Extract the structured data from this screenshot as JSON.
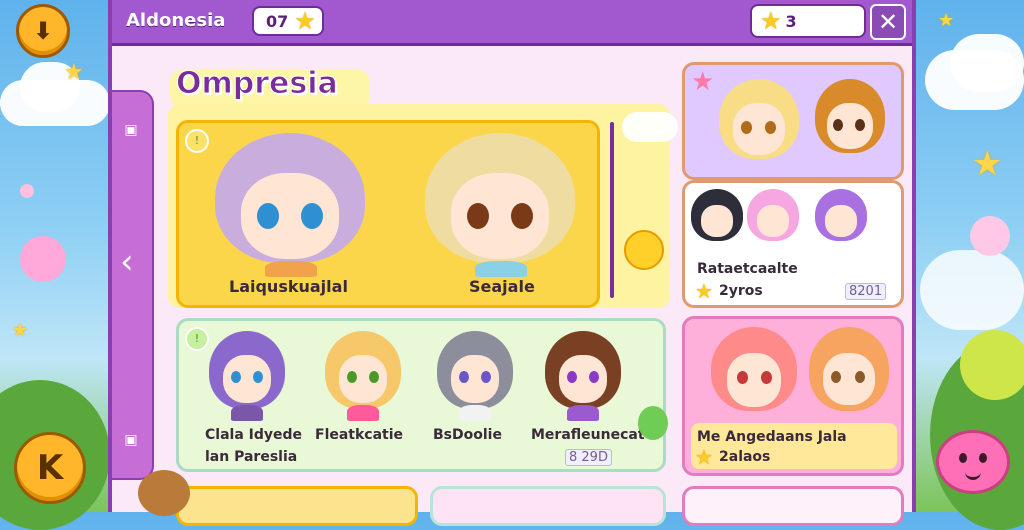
{
  "header": {
    "region_title": "Aldonesia",
    "level_value": "07",
    "star_count": "3"
  },
  "section_title": "Ompresia",
  "featured": [
    {
      "name": "Laiquskuajlal"
    },
    {
      "name": "Seajale"
    }
  ],
  "group_card": {
    "names": [
      "Clala Idyede",
      "Fleatkcatie",
      "BsDoolie",
      "Merafleunecat"
    ],
    "subtitle": "lan Pareslia",
    "tag": "8 29D"
  },
  "side_cards": [
    {
      "title": "Rataetcaalte",
      "stars": "2yros",
      "tag": "8201"
    },
    {
      "title": "Me Angedaans Jala",
      "stars": "2alaos"
    }
  ],
  "icons": {
    "download": "download-arrow-icon",
    "close": "close-x-icon",
    "back": "chevron-left-icon",
    "k_button": "k-letter-icon"
  },
  "colors": {
    "topbar": "#a259d0",
    "panel": "#fbe9f7",
    "accent_gold": "#ffb62b",
    "card_yellow": "#fbd64b",
    "card_pink": "#ffb0da"
  }
}
